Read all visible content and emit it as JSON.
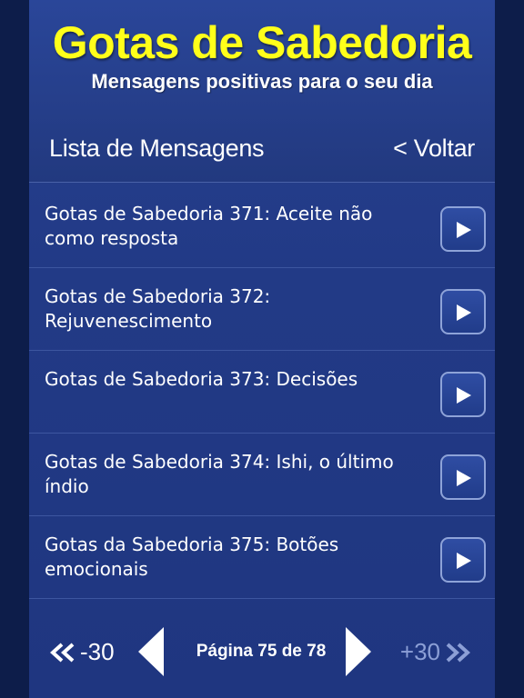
{
  "header": {
    "title": "Gotas de Sabedoria",
    "subtitle": "Mensagens positivas para o seu dia"
  },
  "nav": {
    "list_title": "Lista de Mensagens",
    "back_label": "< Voltar"
  },
  "messages": [
    {
      "title": "Gotas de Sabedoria 371: Aceite não como resposta"
    },
    {
      "title": "Gotas de Sabedoria 372: Rejuvenescimento"
    },
    {
      "title": "Gotas de Sabedoria 373: Decisões"
    },
    {
      "title": "Gotas de Sabedoria 374: Ishi, o último índio"
    },
    {
      "title": "Gotas da Sabedoria 375: Botões emocionais"
    }
  ],
  "pagination": {
    "prev30_label": "-30",
    "next30_label": "+30",
    "page_label": "Página 75 de 78"
  },
  "icons": {
    "play": "play-icon",
    "prev_double": "double-chevron-left-icon",
    "next_double": "double-chevron-right-icon",
    "prev_page": "triangle-left-icon",
    "next_page": "triangle-right-icon"
  },
  "colors": {
    "title": "#ffff1a",
    "background": "#223a86",
    "disabled": "#8c9fd6"
  }
}
